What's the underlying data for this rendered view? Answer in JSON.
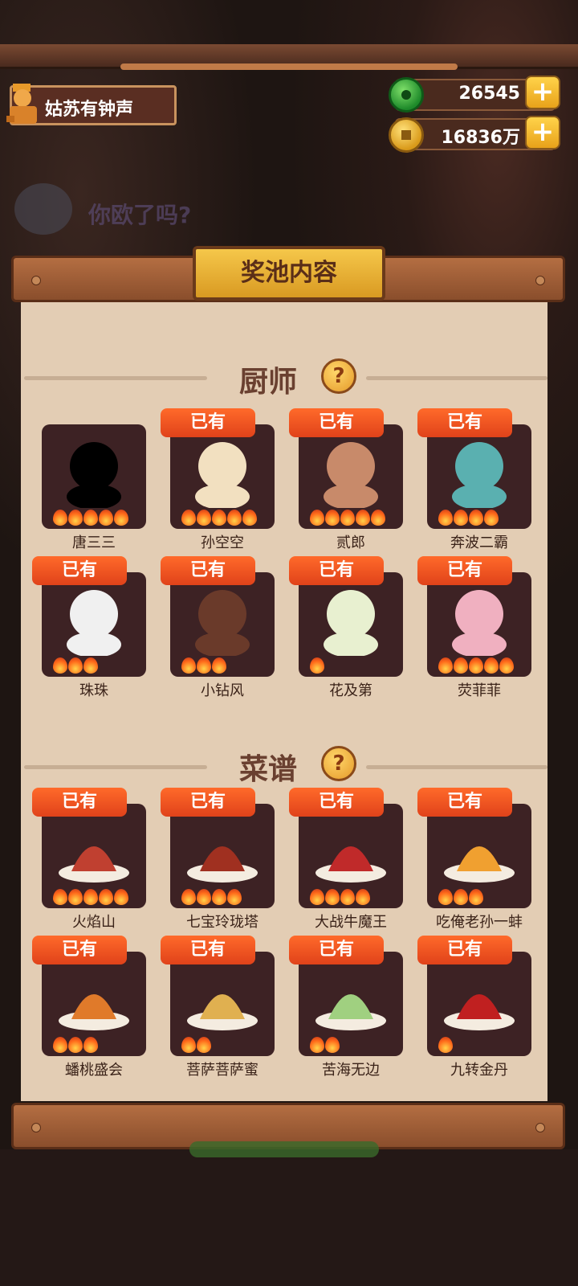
{
  "player": {
    "name": "姑苏有钟声"
  },
  "resources": {
    "jade": "26545",
    "coins": "16836万"
  },
  "notice": "你欧了吗?",
  "panel": {
    "title": "奖池内容"
  },
  "sections": {
    "chefs": {
      "title": "厨师",
      "help_icon": "question-icon"
    },
    "recipes": {
      "title": "菜谱",
      "help_icon": "question-icon"
    }
  },
  "owned_label": "已有",
  "chefs": [
    {
      "name": "唐三三",
      "owned": false,
      "stars": 5
    },
    {
      "name": "孙空空",
      "owned": true,
      "stars": 5
    },
    {
      "name": "贰郎",
      "owned": true,
      "stars": 5
    },
    {
      "name": "奔波二霸",
      "owned": true,
      "stars": 4
    },
    {
      "name": "珠珠",
      "owned": true,
      "stars": 3
    },
    {
      "name": "小钻风",
      "owned": true,
      "stars": 3
    },
    {
      "name": "花及第",
      "owned": true,
      "stars": 1
    },
    {
      "name": "荧菲菲",
      "owned": true,
      "stars": 5
    }
  ],
  "recipes": [
    {
      "name": "火焰山",
      "owned": true,
      "stars": 5
    },
    {
      "name": "七宝玲珑塔",
      "owned": true,
      "stars": 4
    },
    {
      "name": "大战牛魔王",
      "owned": true,
      "stars": 4
    },
    {
      "name": "吃俺老孙一蚌",
      "owned": true,
      "stars": 3
    },
    {
      "name": "蟠桃盛会",
      "owned": true,
      "stars": 3
    },
    {
      "name": "菩萨菩萨蜜",
      "owned": true,
      "stars": 2
    },
    {
      "name": "苦海无边",
      "owned": true,
      "stars": 2
    },
    {
      "name": "九转金丹",
      "owned": true,
      "stars": 1
    }
  ],
  "colors": {
    "badge": "#e84a1e",
    "card": "#3d2224",
    "panel": "#e3cdb4",
    "wood": "#a05a34"
  }
}
